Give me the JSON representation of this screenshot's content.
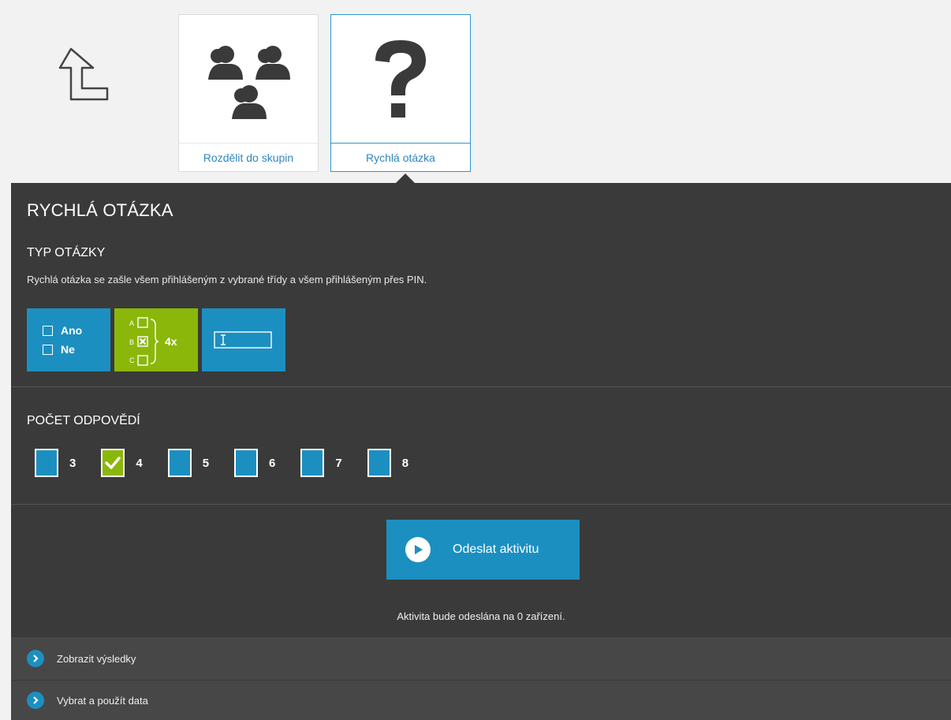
{
  "tiles": [
    {
      "label": "Rozdělit do skupin",
      "icon": "groups-icon"
    },
    {
      "label": "Rychlá otázka",
      "icon": "question-mark-icon"
    }
  ],
  "panel": {
    "title": "RYCHLÁ OTÁZKA",
    "question_type": {
      "heading": "TYP OTÁZKY",
      "description": "Rychlá otázka se zašle všem přihlášeným z vybrané třídy a všem přihlášeným přes PIN.",
      "yes_no": {
        "yes": "Ano",
        "no": "Ne"
      },
      "multiple_choice": {
        "letters": [
          "A",
          "B",
          "C"
        ],
        "count": "4x"
      },
      "selected": "multiple_choice"
    },
    "answer_count": {
      "heading": "POČET ODPOVĚDÍ",
      "options": [
        "3",
        "4",
        "5",
        "6",
        "7",
        "8"
      ],
      "selected": "4"
    },
    "send_button": "Odeslat aktivitu",
    "device_note": "Aktivita bude odeslána na 0 zařízení.",
    "accordion": [
      "Zobrazit výsledky",
      "Vybrat a použít data"
    ]
  },
  "colors": {
    "accent_blue": "#1c8fc1",
    "accent_green": "#8bb70a",
    "panel_bg": "#3a3a3a"
  }
}
